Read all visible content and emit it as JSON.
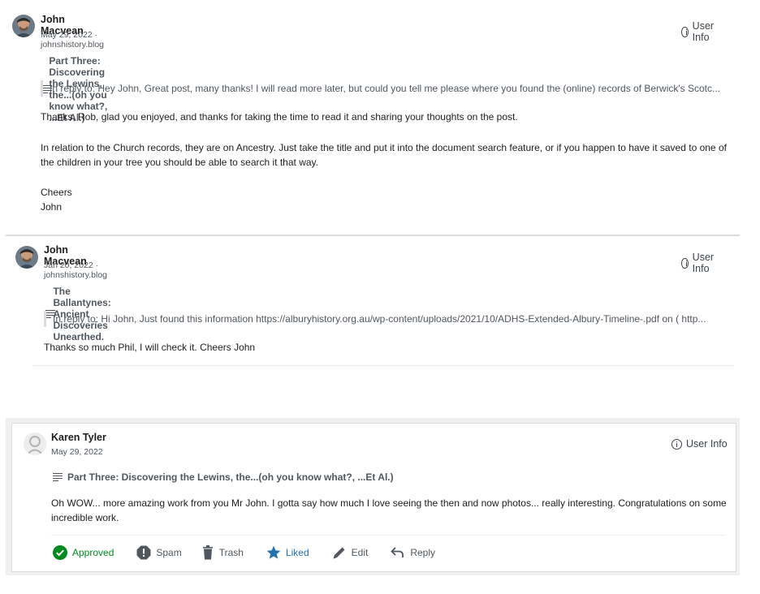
{
  "comments": [
    {
      "author": "John Macvean",
      "meta": "May 29, 2022 · johnshistory.blog",
      "user_info": "User Info",
      "post_title": "Part Three: Discovering the Lewins, the...(oh you know what?, ...Et Al.)",
      "reply_to": "In reply to: Hey John, Great post, many thanks! I will read more later, but could you tell me please where you found the (online) records of Berwick's Scotc...",
      "paragraphs": [
        "Thanks, Rob, glad you enjoyed, and thanks for taking the time to read it and sharing your thoughts on the post.",
        "In relation to the Church records, they are on Ancestry. Just take the title and put it into the document search feature, or if you happen to have it saved to one of the children in your tree you should be able to search it that way.",
        "Cheers",
        "John"
      ]
    },
    {
      "author": "John Macvean",
      "meta": "Jan 20, 2022 · johnshistory.blog",
      "user_info": "User Info",
      "post_title": "The Ballantynes: Ancient Discoveries Unearthed.",
      "reply_to": "In reply to: Hi John, Just found this information https://alburyhistory.org.au/wp-content/uploads/2021/10/ADHS-Extended-Albury-Timeline-.pdf on ( http...",
      "paragraphs": [
        "Thanks so much Phil, I will check it. Cheers John"
      ]
    },
    {
      "author": "Karen Tyler",
      "meta": "May 29, 2022",
      "user_info": "User Info",
      "post_title": "Part Three: Discovering the Lewins, the...(oh you know what?, ...Et Al.)",
      "paragraphs": [
        "Oh WOW... more amazing work from you Mr John. I gotta say how much I love seeing the then and now photos... really interesting. Congratulations on some incredible work."
      ]
    }
  ],
  "actions": {
    "approved": "Approved",
    "spam": "Spam",
    "trash": "Trash",
    "liked": "Liked",
    "edit": "Edit",
    "reply": "Reply"
  },
  "colors": {
    "approved": "#008a20",
    "liked": "#2271b1",
    "muted": "#50575e"
  }
}
